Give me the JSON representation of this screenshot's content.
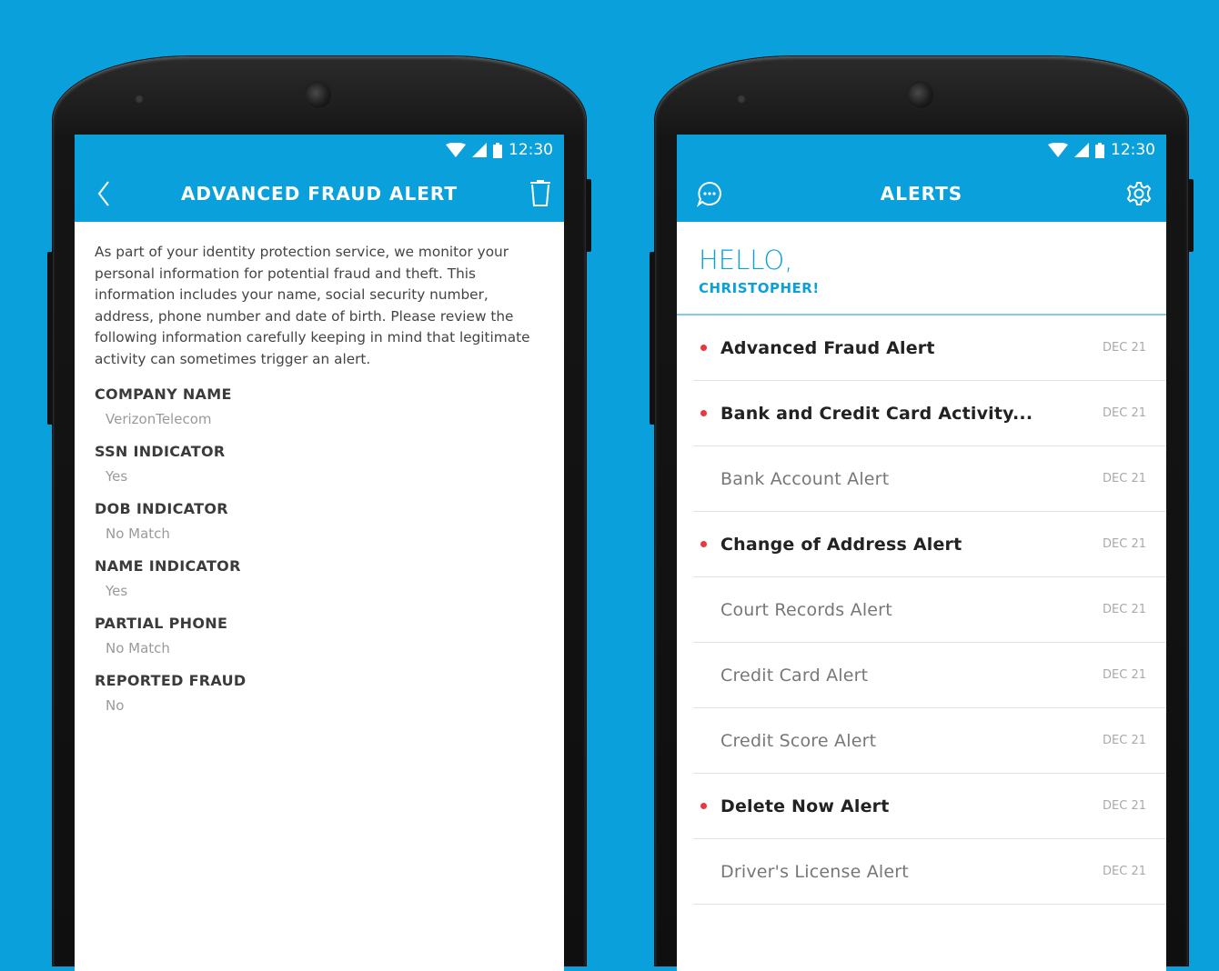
{
  "status_bar": {
    "time": "12:30"
  },
  "detail": {
    "title": "ADVANCED FRAUD ALERT",
    "intro": "As part of your identity protection service, we monitor your personal information for potential fraud and theft. This information includes your name, social security number, address, phone number and date of birth. Please review the following information carefully keeping in mind that legitimate activity can sometimes trigger an alert.",
    "fields": [
      {
        "label": "COMPANY NAME",
        "value": "VerizonTelecom"
      },
      {
        "label": "SSN INDICATOR",
        "value": "Yes"
      },
      {
        "label": "DOB INDICATOR",
        "value": "No Match"
      },
      {
        "label": "NAME INDICATOR",
        "value": "Yes"
      },
      {
        "label": "PARTIAL PHONE",
        "value": "No Match"
      },
      {
        "label": "REPORTED FRAUD",
        "value": "No"
      }
    ]
  },
  "alerts": {
    "title": "ALERTS",
    "greeting": "HELLO,",
    "name": "CHRISTOPHER!",
    "items": [
      {
        "title": "Advanced Fraud Alert",
        "date": "DEC 21",
        "unread": true
      },
      {
        "title": "Bank and Credit Card Activity...",
        "date": "DEC 21",
        "unread": true
      },
      {
        "title": "Bank Account Alert",
        "date": "DEC 21",
        "unread": false
      },
      {
        "title": "Change of Address Alert",
        "date": "DEC 21",
        "unread": true
      },
      {
        "title": "Court Records Alert",
        "date": "DEC 21",
        "unread": false
      },
      {
        "title": "Credit Card Alert",
        "date": "DEC 21",
        "unread": false
      },
      {
        "title": "Credit Score Alert",
        "date": "DEC 21",
        "unread": false
      },
      {
        "title": "Delete Now Alert",
        "date": "DEC 21",
        "unread": true
      },
      {
        "title": "Driver's License Alert",
        "date": "DEC 21",
        "unread": false
      }
    ]
  },
  "colors": {
    "primary": "#0aa0dc",
    "unread_dot": "#e8383d"
  },
  "icons": [
    "wifi-icon",
    "cell-signal-icon",
    "battery-icon",
    "back-icon",
    "trash-icon",
    "chat-icon",
    "settings-icon"
  ]
}
